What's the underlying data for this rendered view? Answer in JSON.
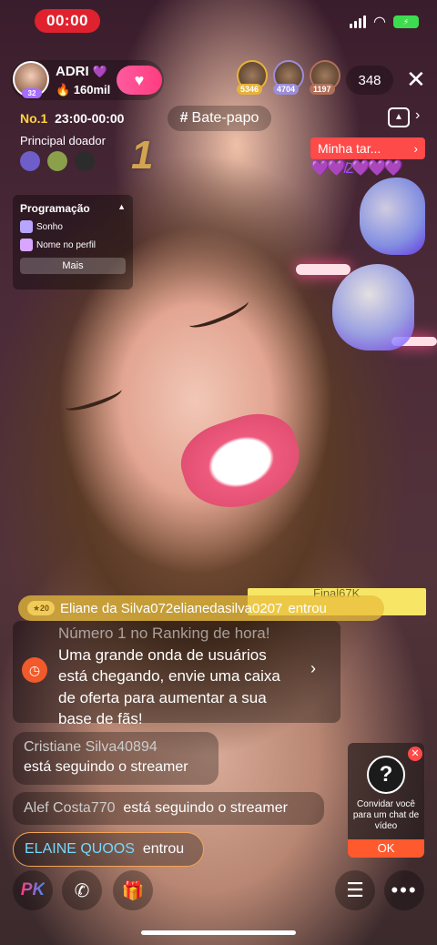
{
  "status_bar": {
    "timer": "00:00"
  },
  "host": {
    "name": "ADRI",
    "heart": "💜",
    "fans": "160mil",
    "level": "32"
  },
  "viewers": [
    {
      "badge": "5346",
      "color": "#e6b23b"
    },
    {
      "badge": "4704",
      "color": "#9c8dd9"
    },
    {
      "badge": "1197",
      "color": "#b1705a"
    }
  ],
  "viewer_count": "348",
  "ranking": {
    "no": "No.1",
    "time": "23:00-00:00"
  },
  "chat_tag": "Bate-papo",
  "top_donor_label": "Principal doador",
  "big_rank": "1",
  "task": {
    "label": "Minha tar...",
    "hearts": "💜💜/2💜💜💜"
  },
  "programacao": {
    "title": "Programação",
    "items": [
      "Sonho",
      "Nome no perfil"
    ],
    "more": "Mais"
  },
  "entry_banner": {
    "level": "20",
    "text": "Eliane da Silva072elianedasilva0207",
    "action": "entrou",
    "overlay": "Final67K"
  },
  "notice": {
    "faded": "Número 1 no Ranking de hora!",
    "lines": [
      "Uma grande onda de usuários",
      "está chegando, envie uma caixa",
      "de oferta  para aumentar a sua",
      "base de fãs!"
    ]
  },
  "messages": [
    {
      "user": "Cristiane Silva40894",
      "text": "está seguindo o streamer"
    },
    {
      "user": "Alef Costa770",
      "text": "está seguindo o streamer"
    },
    {
      "user": "ELAINE QUOOS",
      "text": "entrou"
    }
  ],
  "invite": {
    "text": "Convidar você para um chat de vídeo",
    "ok": "OK"
  },
  "bottom": {
    "pk": "PK"
  },
  "colors": {
    "accent_red": "#e0212e",
    "gold": "#ffd43d",
    "task_red": "#ff4a4a",
    "orange": "#ff5a2e"
  }
}
